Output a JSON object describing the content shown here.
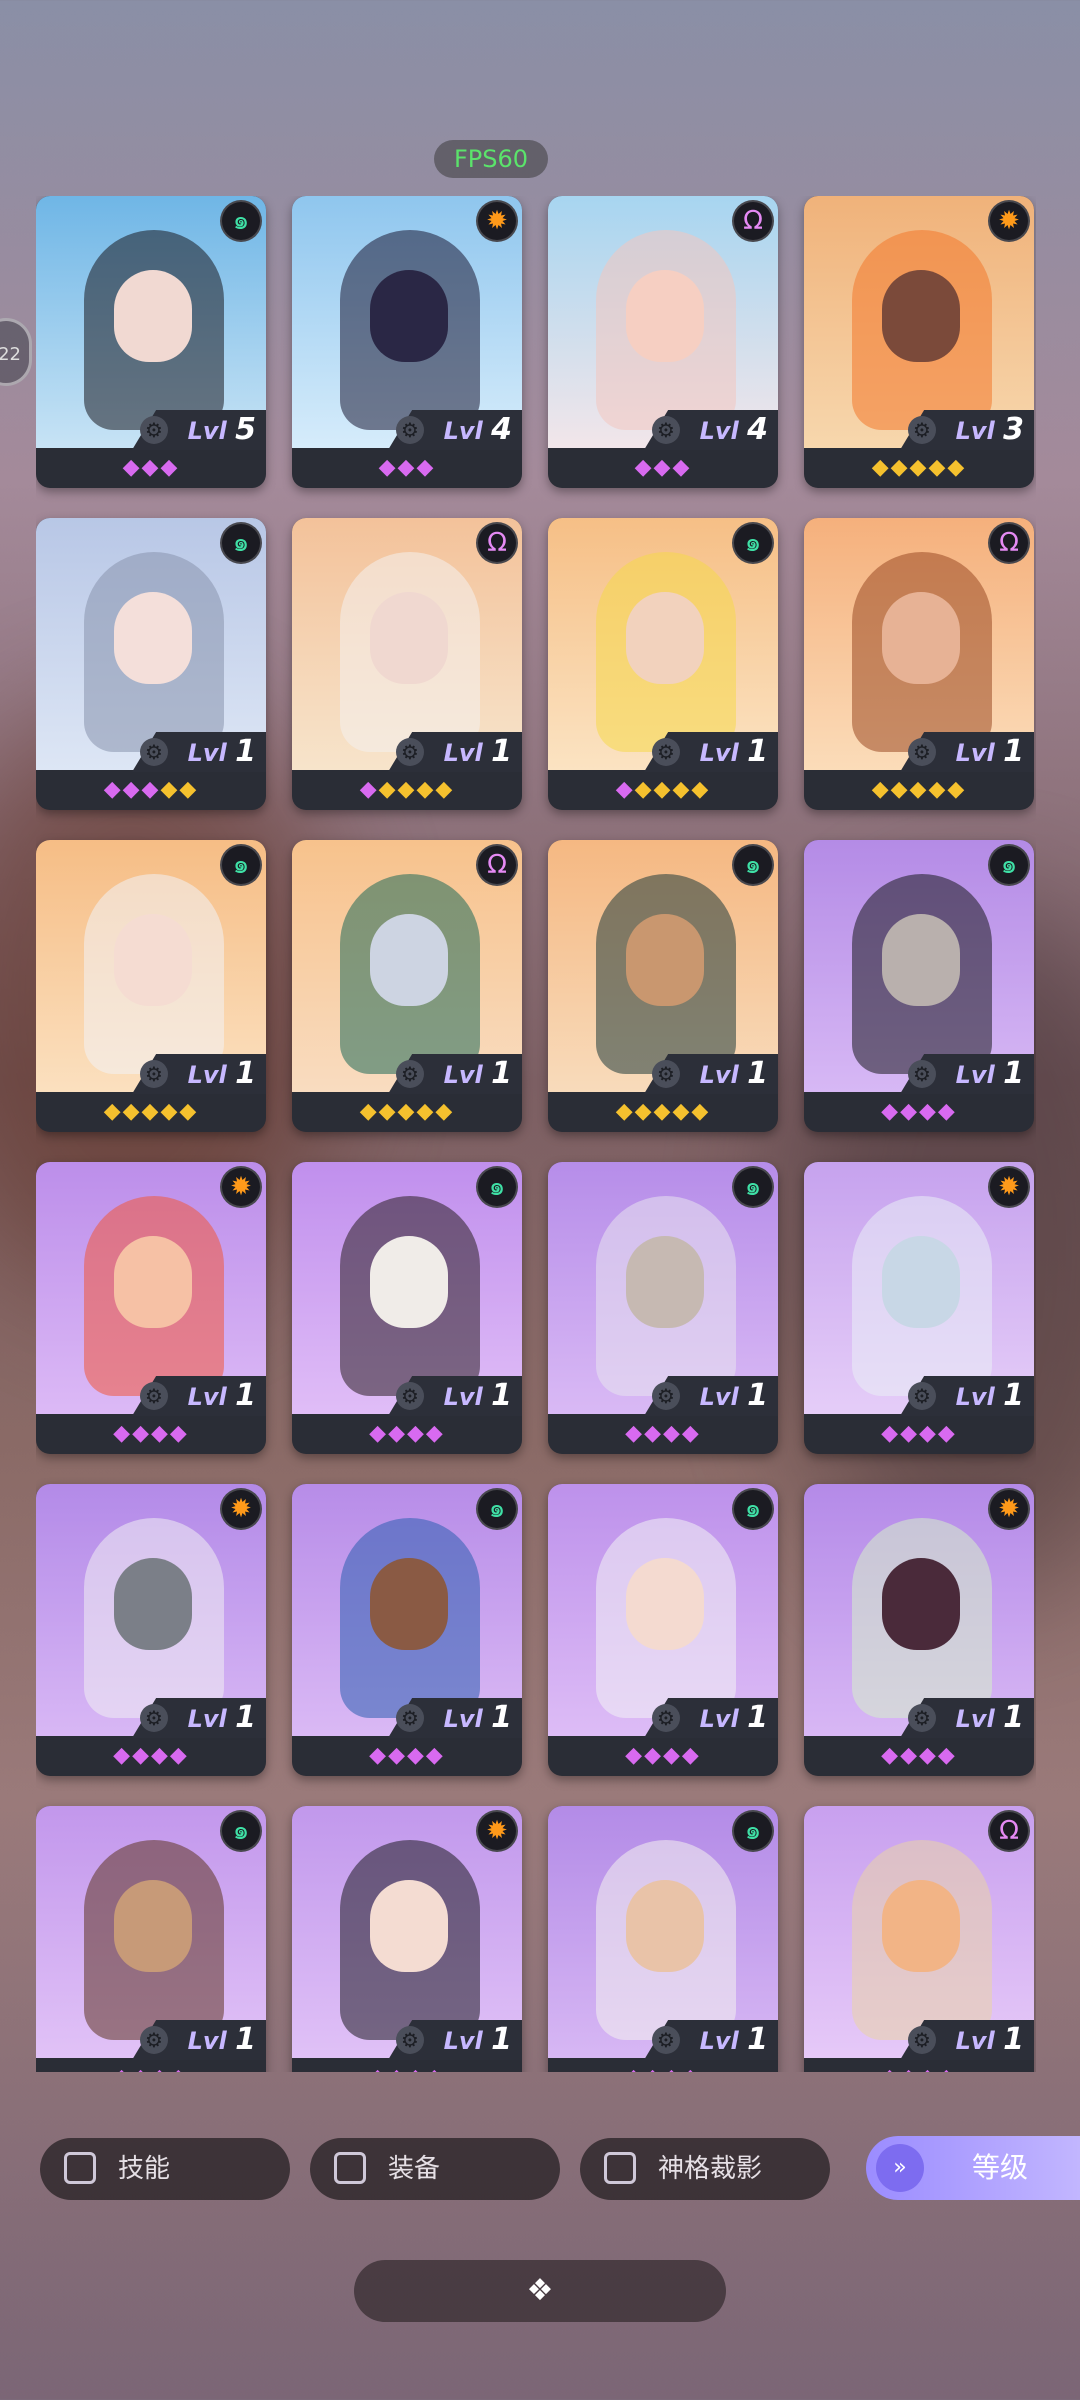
{
  "status": {
    "fps": "FPS60",
    "side_tab": "22"
  },
  "colors": {
    "badge_green": "#3fe0a6",
    "badge_orange": "#ff9a1a",
    "badge_pink": "#e58af4",
    "star_purple": "#d86af0",
    "star_gold": "#f5c12e"
  },
  "level_prefix": "Lvl",
  "cards": [
    {
      "level": "5",
      "badge": "green",
      "stars": [
        "p",
        "p",
        "p"
      ],
      "bg": [
        "#6fb6e6",
        "#c7e3f5"
      ],
      "hair": "#1a1a20",
      "skin": "#f1d9d2"
    },
    {
      "level": "4",
      "badge": "orange",
      "stars": [
        "p",
        "p",
        "p"
      ],
      "bg": [
        "#8fc6ee",
        "#d6ecfb"
      ],
      "hair": "#1c1a35",
      "skin": "#2a2745"
    },
    {
      "level": "4",
      "badge": "pink",
      "stars": [
        "p",
        "p",
        "p"
      ],
      "bg": [
        "#a7d5f0",
        "#f2e6ea"
      ],
      "hair": "#f2c6c0",
      "skin": "#f6cfc2"
    },
    {
      "level": "3",
      "badge": "orange",
      "stars": [
        "g",
        "g",
        "g",
        "g",
        "g"
      ],
      "bg": [
        "#f0b27a",
        "#f7d7ad"
      ],
      "hair": "#f2792b",
      "skin": "#7b4a3a"
    },
    {
      "level": "1",
      "badge": "green",
      "stars": [
        "p",
        "p",
        "p",
        "g",
        "g"
      ],
      "bg": [
        "#b8c7e6",
        "#dde6f5"
      ],
      "hair": "#8894ad",
      "skin": "#f4dfda"
    },
    {
      "level": "1",
      "badge": "pink",
      "stars": [
        "p",
        "g",
        "g",
        "g",
        "g"
      ],
      "bg": [
        "#f3c29a",
        "#f7e4cb"
      ],
      "hair": "#f4f1ee",
      "skin": "#f0d8d0"
    },
    {
      "level": "1",
      "badge": "green",
      "stars": [
        "p",
        "g",
        "g",
        "g",
        "g"
      ],
      "bg": [
        "#f6bf86",
        "#fbe3c2"
      ],
      "hair": "#f5d84a",
      "skin": "#f2d2bd"
    },
    {
      "level": "1",
      "badge": "pink",
      "stars": [
        "g",
        "g",
        "g",
        "g",
        "g"
      ],
      "bg": [
        "#f5b07c",
        "#fbdcb9"
      ],
      "hair": "#9a4a24",
      "skin": "#e7b295"
    },
    {
      "level": "1",
      "badge": "green",
      "stars": [
        "g",
        "g",
        "g",
        "g",
        "g"
      ],
      "bg": [
        "#f6bd85",
        "#fbe0bf"
      ],
      "hair": "#f3f3f6",
      "skin": "#f5dcd2"
    },
    {
      "level": "1",
      "badge": "pink",
      "stars": [
        "g",
        "g",
        "g",
        "g",
        "g"
      ],
      "bg": [
        "#f7c28c",
        "#f9dcc0"
      ],
      "hair": "#1f6a58",
      "skin": "#cdd4e2"
    },
    {
      "level": "1",
      "badge": "green",
      "stars": [
        "g",
        "g",
        "g",
        "g",
        "g"
      ],
      "bg": [
        "#f5b882",
        "#f8dbbb"
      ],
      "hair": "#1f3b3a",
      "skin": "#c9976f"
    },
    {
      "level": "1",
      "badge": "green",
      "stars": [
        "p",
        "p",
        "p",
        "p"
      ],
      "bg": [
        "#b48be6",
        "#d7b8f5"
      ],
      "hair": "#1a1a1f",
      "skin": "#b9b0ad"
    },
    {
      "level": "1",
      "badge": "orange",
      "stars": [
        "p",
        "p",
        "p",
        "p"
      ],
      "bg": [
        "#bc8eea",
        "#dcb9f6"
      ],
      "hair": "#f1573a",
      "skin": "#f6c1a5"
    },
    {
      "level": "1",
      "badge": "green",
      "stars": [
        "p",
        "p",
        "p",
        "p"
      ],
      "bg": [
        "#c08fed",
        "#e0bdf7"
      ],
      "hair": "#2a1f22",
      "skin": "#f0ece8"
    },
    {
      "level": "1",
      "badge": "green",
      "stars": [
        "p",
        "p",
        "p",
        "p"
      ],
      "bg": [
        "#b68de9",
        "#d9b9f5"
      ],
      "hair": "#e8e4ef",
      "skin": "#c6b9b2"
    },
    {
      "level": "1",
      "badge": "orange",
      "stars": [
        "p",
        "p",
        "p",
        "p"
      ],
      "bg": [
        "#c6a2ee",
        "#e5cdf8"
      ],
      "hair": "#e9eef5",
      "skin": "#c8d7e6"
    },
    {
      "level": "1",
      "badge": "orange",
      "stars": [
        "p",
        "p",
        "p",
        "p"
      ],
      "bg": [
        "#b38ae8",
        "#d8b7f5"
      ],
      "hair": "#f0eff2",
      "skin": "#7b7f88"
    },
    {
      "level": "1",
      "badge": "green",
      "stars": [
        "p",
        "p",
        "p",
        "p"
      ],
      "bg": [
        "#b78ce8",
        "#dab9f5"
      ],
      "hair": "#2c5fb0",
      "skin": "#8a5a44"
    },
    {
      "level": "1",
      "badge": "green",
      "stars": [
        "p",
        "p",
        "p",
        "p"
      ],
      "bg": [
        "#bd91eb",
        "#ddbcf6"
      ],
      "hair": "#f2f2f4",
      "skin": "#f4dad0"
    },
    {
      "level": "1",
      "badge": "orange",
      "stars": [
        "p",
        "p",
        "p",
        "p"
      ],
      "bg": [
        "#b48ae8",
        "#d8b7f5"
      ],
      "hair": "#d5f0c8",
      "skin": "#4a2a3a"
    },
    {
      "level": "1",
      "badge": "green",
      "stars": [
        "p",
        "p",
        "p",
        "p"
      ],
      "bg": [
        "#c297ec",
        "#e1c2f7"
      ],
      "hair": "#5e3422",
      "skin": "#c79a78"
    },
    {
      "level": "1",
      "badge": "orange",
      "stars": [
        "p",
        "p",
        "p",
        "p"
      ],
      "bg": [
        "#c198ec",
        "#e0c1f7"
      ],
      "hair": "#1d1b22",
      "skin": "#f4dcd2"
    },
    {
      "level": "1",
      "badge": "green",
      "stars": [
        "p",
        "p",
        "p",
        "p"
      ],
      "bg": [
        "#b38be7",
        "#d7b7f4"
      ],
      "hair": "#f4f2ee",
      "skin": "#e9c3a8"
    },
    {
      "level": "1",
      "badge": "pink",
      "stars": [
        "p",
        "p",
        "p",
        "p"
      ],
      "bg": [
        "#c8a0ef",
        "#e6c9f8"
      ],
      "hair": "#e9d3a5",
      "skin": "#f2b486"
    }
  ],
  "filters": [
    {
      "label": "技能"
    },
    {
      "label": "装备"
    },
    {
      "label": "神格裁影"
    }
  ],
  "level_button": {
    "label": "等级",
    "icon": "double-chevron-down-icon"
  },
  "bottom_button": {
    "icon": "tetris-blocks-icon",
    "glyph": "❖"
  }
}
